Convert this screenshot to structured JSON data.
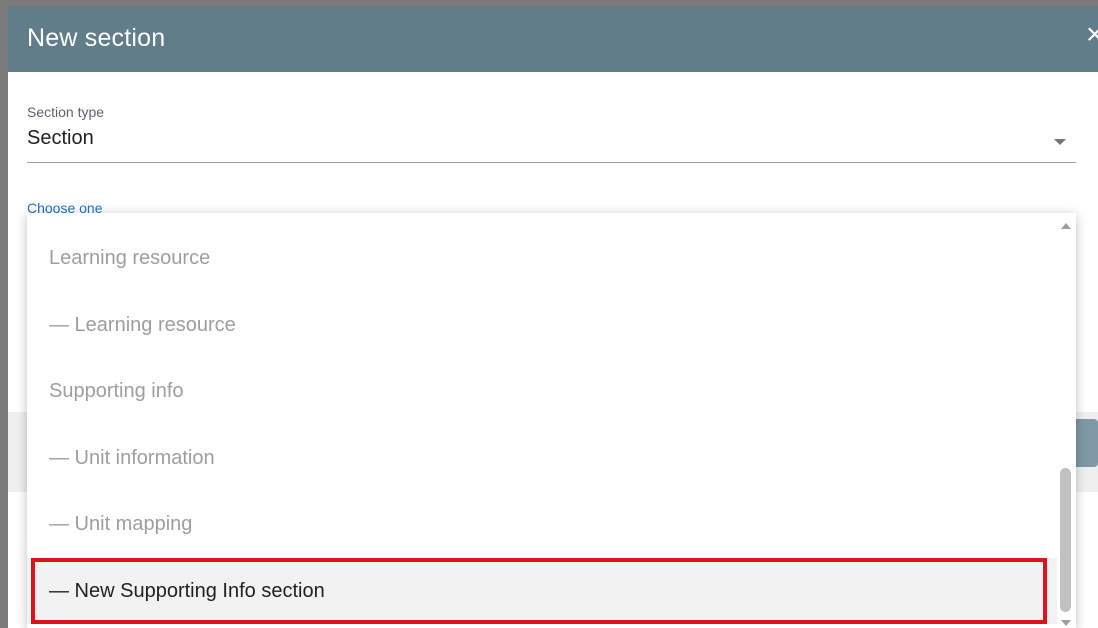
{
  "dialog": {
    "title": "New section",
    "close_icon": "×"
  },
  "section_type": {
    "label": "Section type",
    "value": "Section"
  },
  "choose": {
    "label": "Choose one"
  },
  "menu": {
    "items": [
      {
        "label": "Learning resource",
        "selected": false
      },
      {
        "label": "— Learning resource",
        "selected": false
      },
      {
        "label": "Supporting info",
        "selected": false
      },
      {
        "label": "— Unit information",
        "selected": false
      },
      {
        "label": "— Unit mapping",
        "selected": false
      },
      {
        "label": "— New Supporting Info section",
        "selected": true
      }
    ]
  },
  "colors": {
    "titlebar": "#617d8a",
    "choose_label": "#1a73c8",
    "highlight": "#e0121b"
  }
}
